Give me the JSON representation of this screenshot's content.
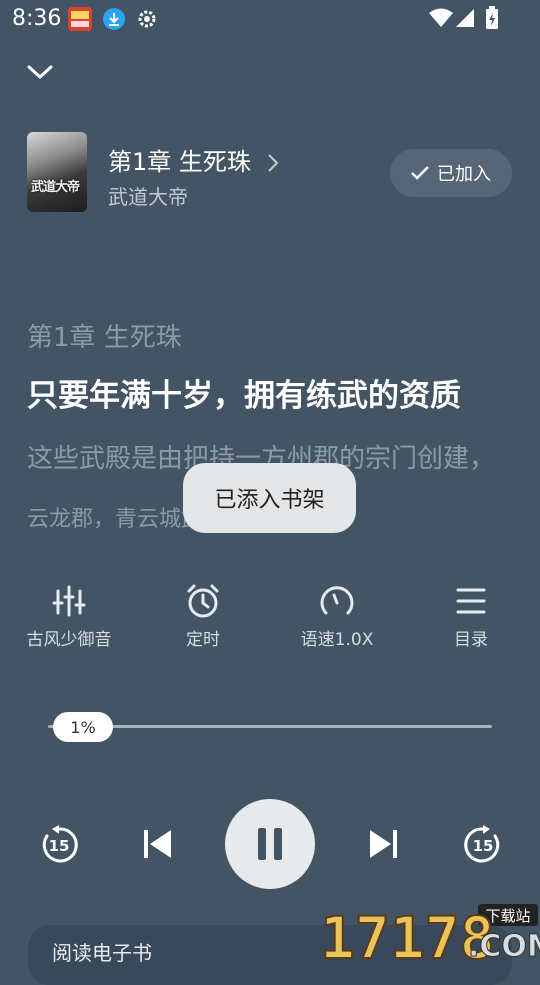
{
  "status_bar": {
    "time": "8:36",
    "icons": [
      "app-notification-icon",
      "download-icon",
      "settings-gear-icon",
      "wifi-icon",
      "cell-signal-icon",
      "battery-icon"
    ]
  },
  "header": {
    "collapse_icon": "chevron-down-icon",
    "cover_title": "武道大帝",
    "chapter_title": "第1章 生死珠",
    "book_title": "武道大帝",
    "added_button_label": "已加入"
  },
  "reader": {
    "chapter_heading": "第1章 生死珠",
    "current_line": "只要年满十岁，拥有练武的资质",
    "next_line": "这些武殿是由把持一方州郡的宗门创建，",
    "next_line_2": "云龙郡，青云城武殿。"
  },
  "toast": {
    "message": "已添入书架"
  },
  "controls": [
    {
      "icon": "voice-equalizer-icon",
      "label": "古风少御音"
    },
    {
      "icon": "alarm-clock-icon",
      "label": "定时"
    },
    {
      "icon": "speed-gauge-icon",
      "label": "语速1.0X"
    },
    {
      "icon": "list-menu-icon",
      "label": "目录"
    }
  ],
  "progress": {
    "label": "1%",
    "fraction": 0.01
  },
  "player": {
    "rewind_label": "15",
    "forward_label": "15",
    "state": "playing"
  },
  "bottom_bar": {
    "label": "阅读电子书"
  },
  "watermark": {
    "text": "17178",
    "suffix": ".COM",
    "badge": "下载站"
  }
}
